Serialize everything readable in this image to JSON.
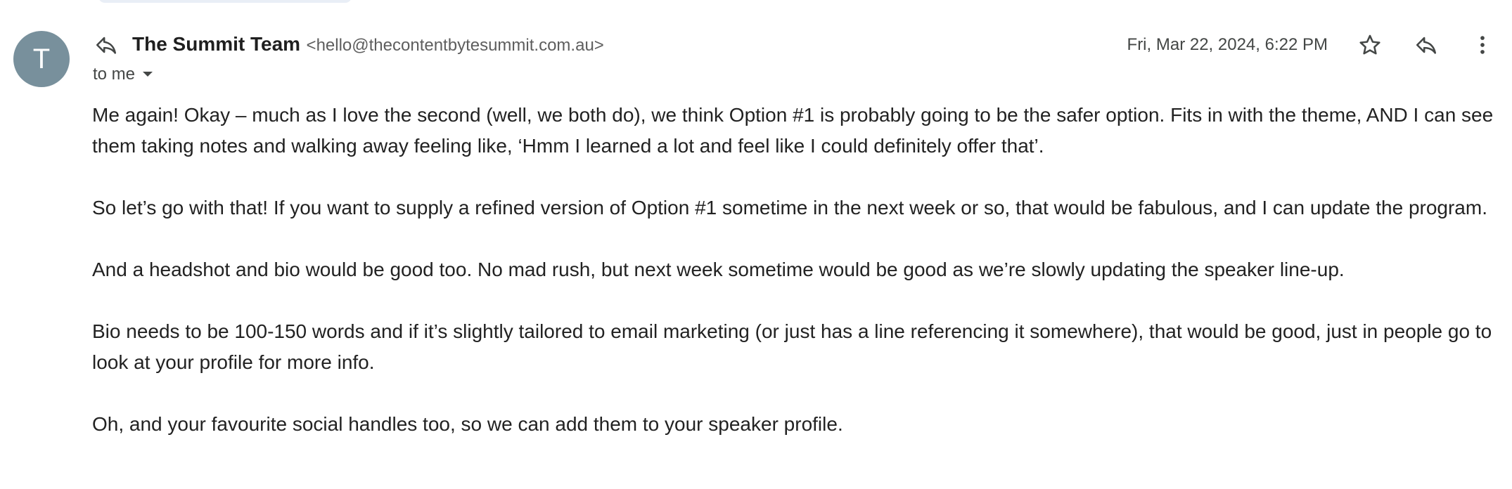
{
  "email": {
    "avatar_initial": "T",
    "sender_name": "The Summit Team",
    "sender_email": "<hello@thecontentbytesummit.com.au>",
    "recipient": "to me",
    "date": "Fri, Mar 22, 2024, 6:22 PM",
    "body": [
      "Me again! Okay – much as I love the second (well, we both do), we think Option #1 is probably going to be the safer option. Fits in with the theme, AND I can see them taking notes and walking away feeling like, ‘Hmm I learned a lot and feel like I could definitely offer that’.",
      "So let’s go with that! If you want to supply a refined version of Option #1 sometime in the next week or so, that would be fabulous, and I can update the program.",
      "And a headshot and bio would be good too. No mad rush, but next week sometime would be good as we’re slowly updating the speaker line-up.",
      "Bio needs to be 100-150 words and if it’s slightly tailored to email marketing (or just has a line referencing it somewhere), that would be good, just in people go to look at your profile for more info.",
      "Oh, and your favourite social handles too, so we can add them to your speaker profile."
    ]
  },
  "icons": {
    "reply_indicator": "reply-icon",
    "star": "star-icon",
    "reply": "reply-icon",
    "more": "more-vert-icon",
    "caret": "caret-down-icon"
  },
  "colors": {
    "avatar_bg": "#78909c",
    "text_primary": "#1f1f1f",
    "text_secondary": "#444746"
  }
}
